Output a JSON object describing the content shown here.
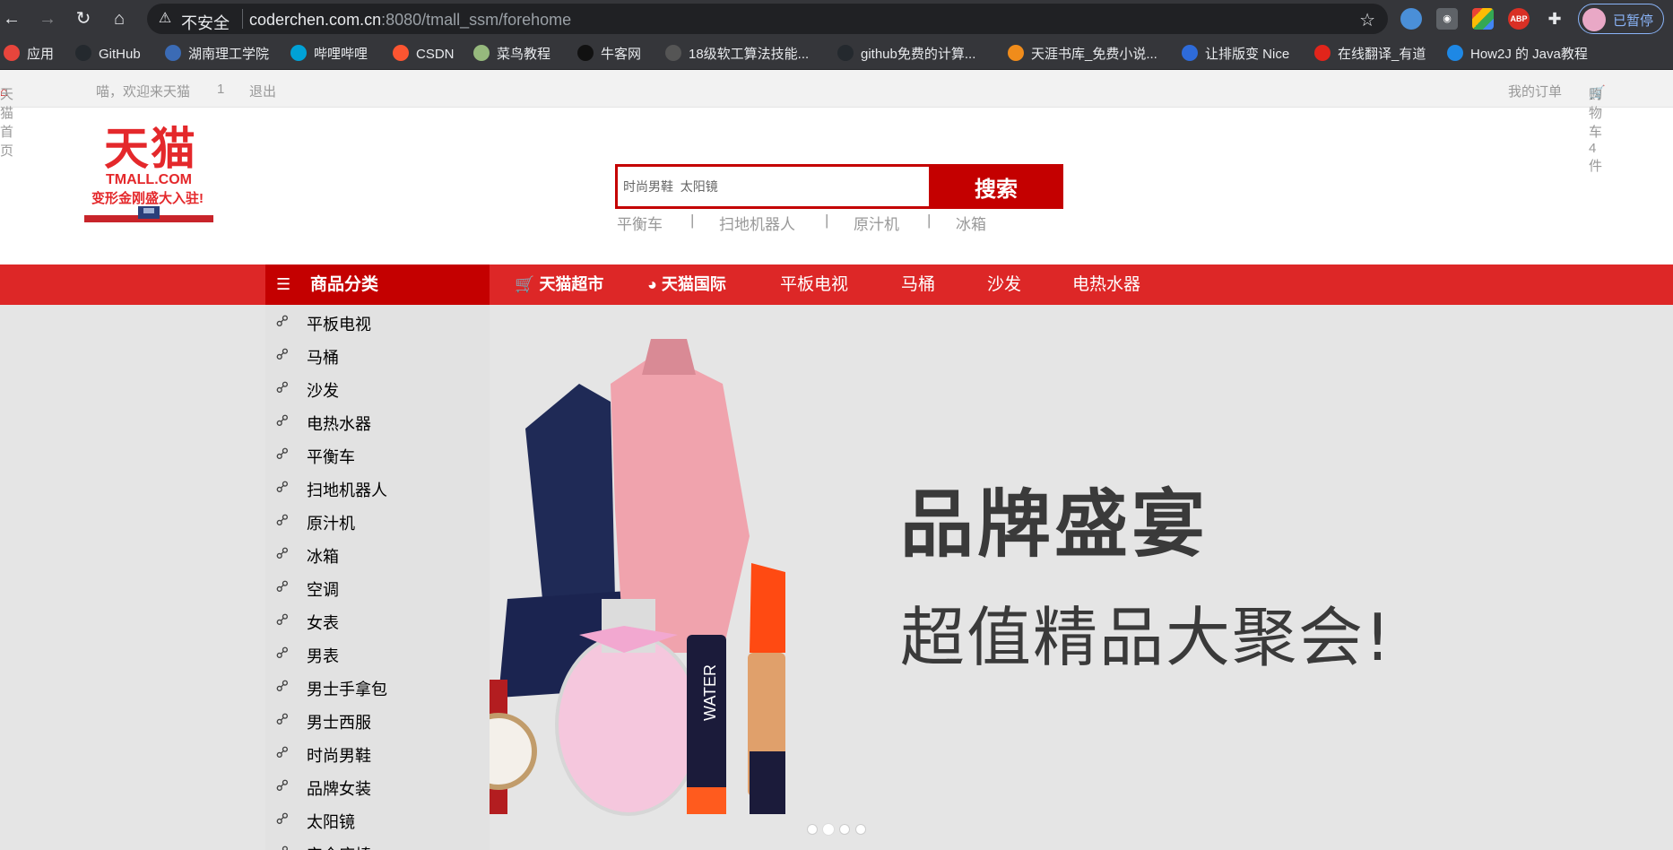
{
  "browser": {
    "insecure_label": "不安全",
    "url_host": "coderchen.com.cn",
    "url_rest": ":8080/tmall_ssm/forehome",
    "profile_label": "已暂停",
    "ext_abp": "ABP"
  },
  "bookmarks": [
    {
      "label": "应用",
      "icon": "apps-grid-icon",
      "color": "#e8453c"
    },
    {
      "label": "GitHub",
      "icon": "github-icon",
      "color": "#24292e"
    },
    {
      "label": "湖南理工学院",
      "icon": "school-icon",
      "color": "#3b6bb5"
    },
    {
      "label": "哔哩哔哩",
      "icon": "bilibili-icon",
      "color": "#00a1d6"
    },
    {
      "label": "CSDN",
      "icon": "csdn-icon",
      "color": "#fc5531"
    },
    {
      "label": "菜鸟教程",
      "icon": "runoob-icon",
      "color": "#96b97d"
    },
    {
      "label": "牛客网",
      "icon": "nowcoder-icon",
      "color": "#111111"
    },
    {
      "label": "18级软工算法技能...",
      "icon": "page-icon",
      "color": "#555555"
    },
    {
      "label": "github免费的计算...",
      "icon": "github-icon",
      "color": "#24292e"
    },
    {
      "label": "天涯书库_免费小说...",
      "icon": "book-icon",
      "color": "#f08c1b"
    },
    {
      "label": "让排版变 Nice",
      "icon": "nice-icon",
      "color": "#2e6bd9"
    },
    {
      "label": "在线翻译_有道",
      "icon": "youdao-icon",
      "color": "#e1251b"
    },
    {
      "label": "How2J 的 Java教程",
      "icon": "how2j-icon",
      "color": "#1e88e5"
    }
  ],
  "topbar": {
    "home": "天猫首页",
    "welcome": "喵，欢迎来天猫",
    "user": "1",
    "logout": "退出",
    "orders": "我的订单",
    "cart": "购物车4件"
  },
  "logo": {
    "cn": "天猫",
    "en": "TMALL.COM",
    "slogan": "变形金刚盛大入驻!"
  },
  "search": {
    "value": "时尚男鞋  太阳镜",
    "button": "搜索",
    "hot_words": [
      "平衡车",
      "扫地机器人",
      "原汁机",
      "冰箱"
    ],
    "separator": "|"
  },
  "nav": {
    "category_header": "商品分类",
    "links": [
      "天猫超市",
      "天猫国际",
      "平板电视",
      "马桶",
      "沙发",
      "电热水器"
    ]
  },
  "categories": [
    "平板电视",
    "马桶",
    "沙发",
    "电热水器",
    "平衡车",
    "扫地机器人",
    "原汁机",
    "冰箱",
    "空调",
    "女表",
    "男表",
    "男士手拿包",
    "男士西服",
    "时尚男鞋",
    "品牌女装",
    "太阳镜",
    "安全座椅"
  ],
  "banner": {
    "title": "品牌盛宴",
    "subtitle": "超值精品大聚会!",
    "perfume_text": "WATER"
  },
  "colors": {
    "brand_red": "#c40000",
    "nav_red": "#dd2727"
  }
}
